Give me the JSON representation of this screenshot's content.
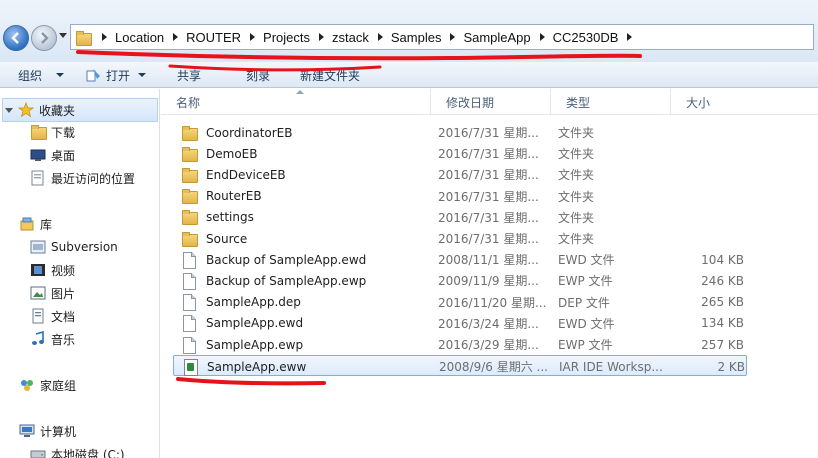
{
  "address": {
    "breadcrumbs": [
      "Location",
      "ROUTER",
      "Projects",
      "zstack",
      "Samples",
      "SampleApp",
      "CC2530DB"
    ]
  },
  "toolbar": {
    "organize": "组织",
    "open": "打开",
    "share": "共享",
    "burn": "刻录",
    "new_folder": "新建文件夹"
  },
  "nav": {
    "favorites": "收藏夹",
    "downloads": "下载",
    "desktop": "桌面",
    "recent": "最近访问的位置",
    "libraries": "库",
    "subversion": "Subversion",
    "videos": "视频",
    "pictures": "图片",
    "documents": "文档",
    "music": "音乐",
    "homegroup": "家庭组",
    "computer": "计算机",
    "local_disk": "本地磁盘 (C:)"
  },
  "columns": {
    "name": "名称",
    "date": "修改日期",
    "type": "类型",
    "size": "大小"
  },
  "files": [
    {
      "name": "CoordinatorEB",
      "date": "2016/7/31 星期...",
      "type": "文件夹",
      "size": "",
      "icon": "folder-icon"
    },
    {
      "name": "DemoEB",
      "date": "2016/7/31 星期...",
      "type": "文件夹",
      "size": "",
      "icon": "folder-icon"
    },
    {
      "name": "EndDeviceEB",
      "date": "2016/7/31 星期...",
      "type": "文件夹",
      "size": "",
      "icon": "folder-icon"
    },
    {
      "name": "RouterEB",
      "date": "2016/7/31 星期...",
      "type": "文件夹",
      "size": "",
      "icon": "folder-icon"
    },
    {
      "name": "settings",
      "date": "2016/7/31 星期...",
      "type": "文件夹",
      "size": "",
      "icon": "folder-icon"
    },
    {
      "name": "Source",
      "date": "2016/7/31 星期...",
      "type": "文件夹",
      "size": "",
      "icon": "folder-icon"
    },
    {
      "name": "Backup of SampleApp.ewd",
      "date": "2008/11/1 星期...",
      "type": "EWD 文件",
      "size": "104 KB",
      "icon": "file-icon"
    },
    {
      "name": "Backup of SampleApp.ewp",
      "date": "2009/11/9 星期...",
      "type": "EWP 文件",
      "size": "246 KB",
      "icon": "file-icon"
    },
    {
      "name": "SampleApp.dep",
      "date": "2016/11/20 星期...",
      "type": "DEP 文件",
      "size": "265 KB",
      "icon": "file-icon"
    },
    {
      "name": "SampleApp.ewd",
      "date": "2016/3/24 星期...",
      "type": "EWD 文件",
      "size": "134 KB",
      "icon": "file-icon"
    },
    {
      "name": "SampleApp.ewp",
      "date": "2016/3/29 星期...",
      "type": "EWP 文件",
      "size": "257 KB",
      "icon": "file-icon"
    },
    {
      "name": "SampleApp.eww",
      "date": "2008/9/6 星期六 ...",
      "type": "IAR IDE Worksp...",
      "size": "2 KB",
      "icon": "iar-workspace-icon",
      "selected": true
    }
  ],
  "colors": {
    "annotation_red": "#e8121a",
    "selection_border": "#84acdd",
    "toolbar_text": "#1e395b"
  }
}
